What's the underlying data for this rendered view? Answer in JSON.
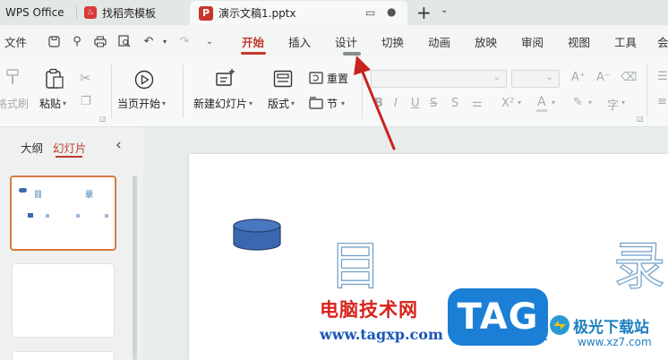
{
  "titlebar": {
    "tabs": [
      {
        "label": "WPS Office"
      },
      {
        "label": "找稻壳模板"
      },
      {
        "label": "演示文稿1.pptx"
      }
    ],
    "new_tab_symbol": "+"
  },
  "menu": {
    "file": "文件",
    "items": [
      "开始",
      "插入",
      "设计",
      "切换",
      "动画",
      "放映",
      "审阅",
      "视图",
      "工具",
      "会"
    ],
    "active_index": 0,
    "accent": "#c0392b"
  },
  "ribbon": {
    "format_painter": "格式刷",
    "paste": "粘贴",
    "from_current": "当页开始",
    "new_slide": "新建幻灯片",
    "layout": "版式",
    "reset": "重置",
    "section": "节"
  },
  "left_panel": {
    "tab_outline": "大纲",
    "tab_slides": "幻灯片",
    "collapse_symbol": "‹"
  },
  "thumb1": {
    "title_left": "目",
    "title_right": "录"
  },
  "slide": {
    "char_left": "目",
    "char_right": "录"
  },
  "watermarks": {
    "site_cn": "电脑技术网",
    "site_url": "www.tagxp.com",
    "tag": "TAG",
    "xz_cn": "极光下载站",
    "xz_url": "www.xz7.com"
  }
}
